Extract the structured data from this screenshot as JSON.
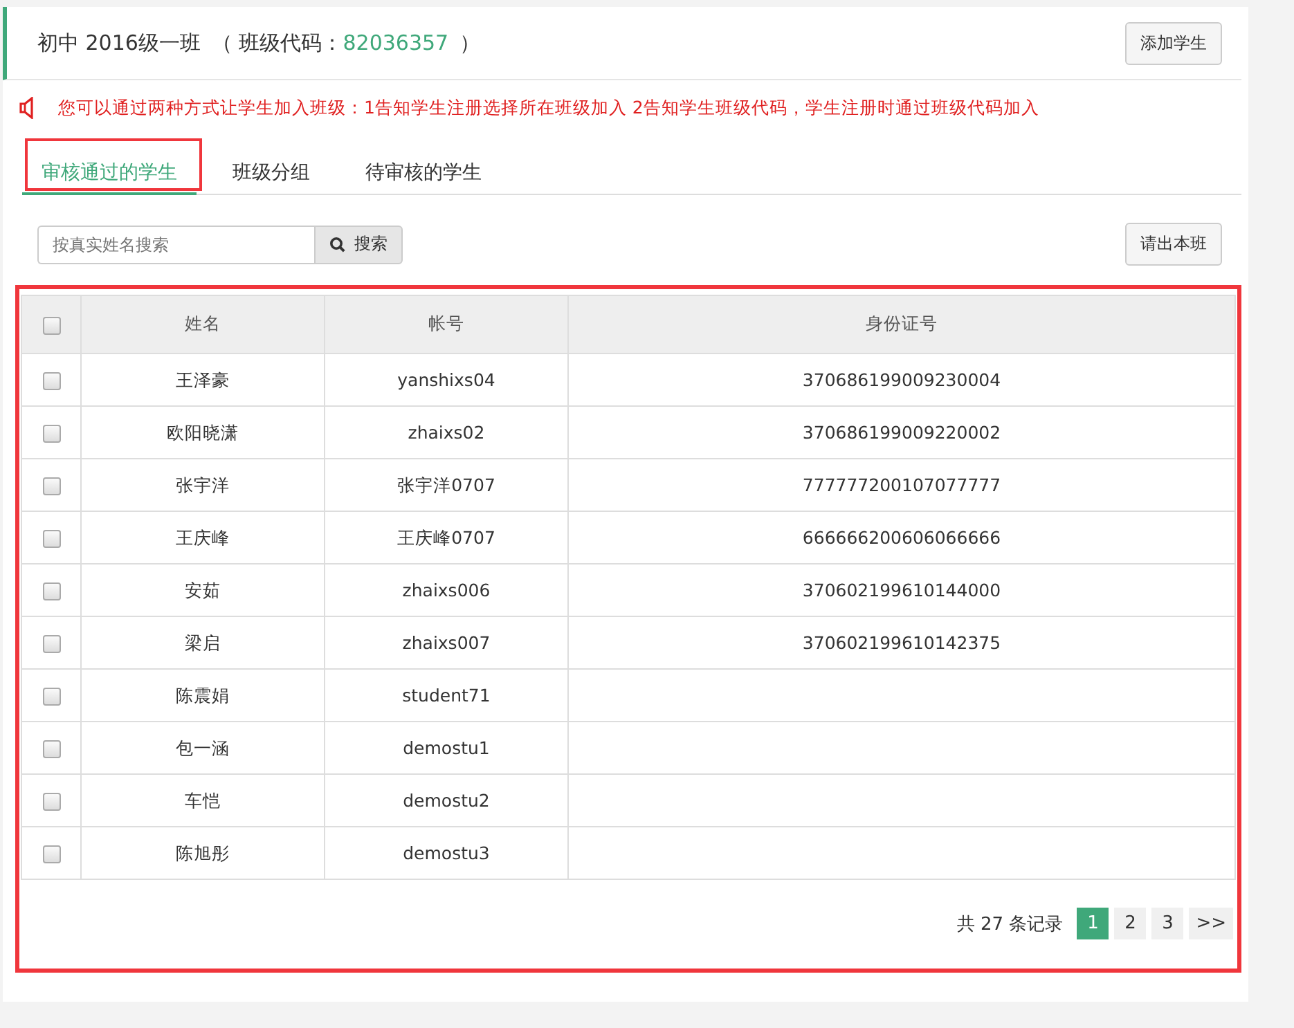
{
  "header": {
    "class_name": "初中 2016级一班",
    "code_label_open": "（ 班级代码：",
    "code": "82036357",
    "code_label_close": "）",
    "add_button": "添加学生"
  },
  "notice": "您可以通过两种方式让学生加入班级：1告知学生注册选择所在班级加入 2告知学生班级代码，学生注册时通过班级代码加入",
  "tabs": [
    {
      "label": "审核通过的学生",
      "selected": true,
      "highlighted": true
    },
    {
      "label": "班级分组",
      "selected": false,
      "highlighted": false
    },
    {
      "label": "待审核的学生",
      "selected": false,
      "highlighted": false
    }
  ],
  "search": {
    "placeholder": "按真实姓名搜索",
    "button": "搜索"
  },
  "remove_button": "请出本班",
  "table": {
    "highlighted": true,
    "all_checked": false,
    "columns": [
      "姓名",
      "帐号",
      "身份证号"
    ],
    "rows": [
      {
        "checked": false,
        "cells": [
          "王泽豪",
          "yanshixs04",
          "370686199009230004"
        ]
      },
      {
        "checked": false,
        "cells": [
          "欧阳晓潇",
          "zhaixs02",
          "370686199009220002"
        ]
      },
      {
        "checked": false,
        "cells": [
          "张宇洋",
          "张宇洋0707",
          "777777200107077777"
        ]
      },
      {
        "checked": false,
        "cells": [
          "王庆峰",
          "王庆峰0707",
          "666666200606066666"
        ]
      },
      {
        "checked": false,
        "cells": [
          "安茹",
          "zhaixs006",
          "370602199610144000"
        ]
      },
      {
        "checked": false,
        "cells": [
          "梁启",
          "zhaixs007",
          "370602199610142375"
        ]
      },
      {
        "checked": false,
        "cells": [
          "陈震娟",
          "student71",
          ""
        ]
      },
      {
        "checked": false,
        "cells": [
          "包一涵",
          "demostu1",
          ""
        ]
      },
      {
        "checked": false,
        "cells": [
          "车恺",
          "demostu2",
          ""
        ]
      },
      {
        "checked": false,
        "cells": [
          "陈旭彤",
          "demostu3",
          ""
        ]
      }
    ]
  },
  "pagination": {
    "total": "共 27 条记录",
    "pages": [
      {
        "label": "1",
        "selected": true
      },
      {
        "label": "2",
        "selected": false
      },
      {
        "label": "3",
        "selected": false
      }
    ],
    "next": ">>"
  }
}
